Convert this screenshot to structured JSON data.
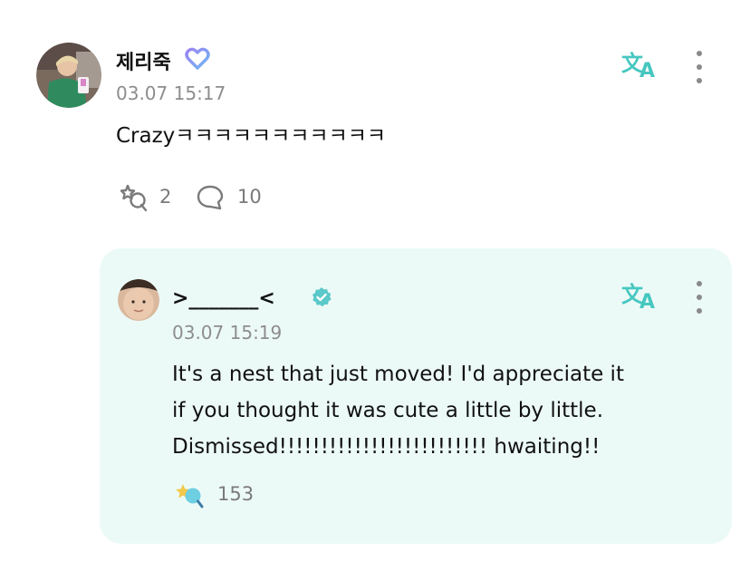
{
  "post": {
    "author": "제리죽",
    "timestamp": "03.07 15:17",
    "text": "Crazyㅋㅋㅋㅋㅋㅋㅋㅋㅋㅋㅋ",
    "reactions_count": "2",
    "comments_count": "10",
    "icons": {
      "badge": "heart-badge-icon",
      "translate": "translate-icon",
      "more": "more-vertical-icon",
      "reaction": "reaction-icon",
      "comment": "comment-icon"
    }
  },
  "reply": {
    "author": ">_______<",
    "timestamp": "03.07 15:19",
    "text": "It's a nest that just moved! I'd appreciate it if you thought it was cute a little by little. Dismissed!!!!!!!!!!!!!!!!!!!!!!!!! hwaiting!!",
    "lines": [
      "It's a nest that just moved! I'd appreciate it",
      "if you thought it was cute a little by little.",
      "Dismissed!!!!!!!!!!!!!!!!!!!!!!!!! hwaiting!!"
    ],
    "reactions_count": "153",
    "icons": {
      "badge": "verified-check-icon",
      "translate": "translate-icon",
      "more": "more-vertical-icon",
      "reaction": "artist-reaction-icon"
    }
  },
  "colors": {
    "accent": "#46c7c0",
    "badge_purple": "#8c7ff0",
    "badge_blue": "#6fb6f2",
    "verified": "#5bc8c9",
    "reply_bg": "#ecfaf7",
    "muted": "#8d8d8d"
  }
}
